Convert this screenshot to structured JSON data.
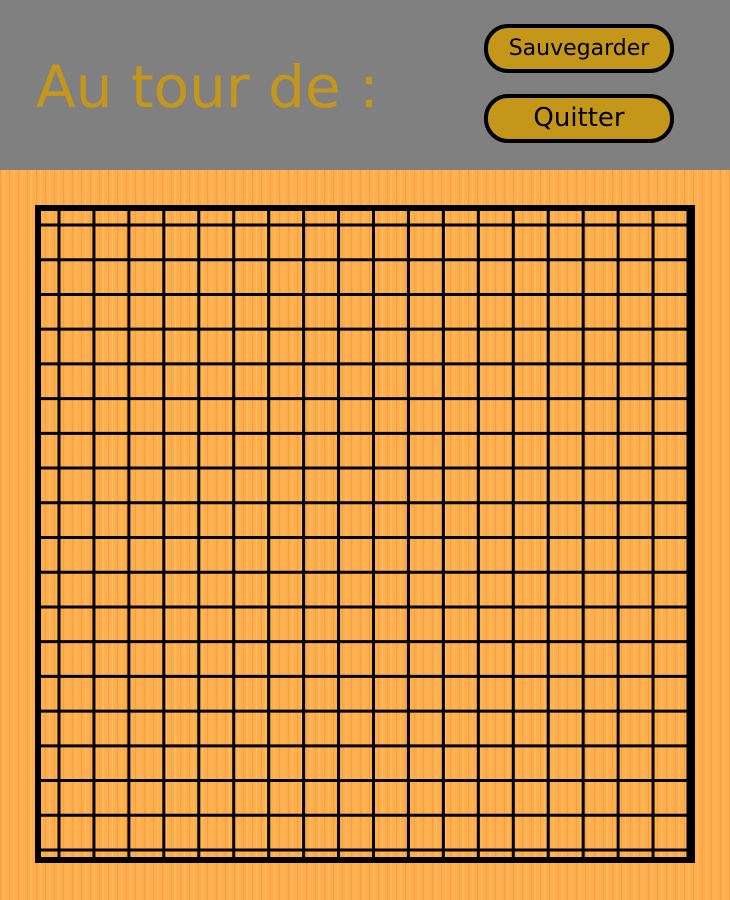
{
  "header": {
    "turn_label": "Au tour de :",
    "save_label": "Sauvegarder",
    "quit_label": "Quitter"
  },
  "board": {
    "lines": 19,
    "line_color": "#000000",
    "wood_color": "#ffae4d"
  },
  "colors": {
    "header_bg": "#808080",
    "accent": "#c4961a",
    "text": "#000000"
  }
}
